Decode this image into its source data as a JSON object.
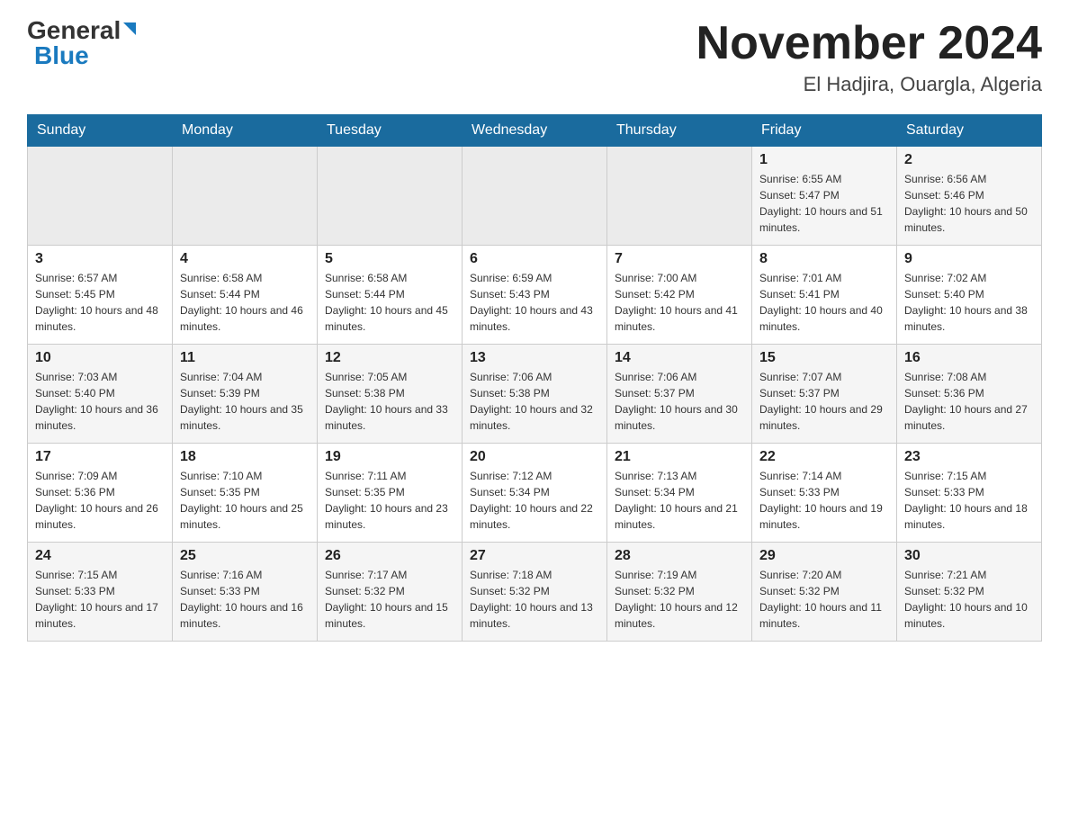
{
  "logo": {
    "general": "General",
    "blue": "Blue"
  },
  "calendar": {
    "title": "November 2024",
    "subtitle": "El Hadjira, Ouargla, Algeria",
    "days_of_week": [
      "Sunday",
      "Monday",
      "Tuesday",
      "Wednesday",
      "Thursday",
      "Friday",
      "Saturday"
    ],
    "weeks": [
      [
        {
          "day": "",
          "info": ""
        },
        {
          "day": "",
          "info": ""
        },
        {
          "day": "",
          "info": ""
        },
        {
          "day": "",
          "info": ""
        },
        {
          "day": "",
          "info": ""
        },
        {
          "day": "1",
          "info": "Sunrise: 6:55 AM\nSunset: 5:47 PM\nDaylight: 10 hours and 51 minutes."
        },
        {
          "day": "2",
          "info": "Sunrise: 6:56 AM\nSunset: 5:46 PM\nDaylight: 10 hours and 50 minutes."
        }
      ],
      [
        {
          "day": "3",
          "info": "Sunrise: 6:57 AM\nSunset: 5:45 PM\nDaylight: 10 hours and 48 minutes."
        },
        {
          "day": "4",
          "info": "Sunrise: 6:58 AM\nSunset: 5:44 PM\nDaylight: 10 hours and 46 minutes."
        },
        {
          "day": "5",
          "info": "Sunrise: 6:58 AM\nSunset: 5:44 PM\nDaylight: 10 hours and 45 minutes."
        },
        {
          "day": "6",
          "info": "Sunrise: 6:59 AM\nSunset: 5:43 PM\nDaylight: 10 hours and 43 minutes."
        },
        {
          "day": "7",
          "info": "Sunrise: 7:00 AM\nSunset: 5:42 PM\nDaylight: 10 hours and 41 minutes."
        },
        {
          "day": "8",
          "info": "Sunrise: 7:01 AM\nSunset: 5:41 PM\nDaylight: 10 hours and 40 minutes."
        },
        {
          "day": "9",
          "info": "Sunrise: 7:02 AM\nSunset: 5:40 PM\nDaylight: 10 hours and 38 minutes."
        }
      ],
      [
        {
          "day": "10",
          "info": "Sunrise: 7:03 AM\nSunset: 5:40 PM\nDaylight: 10 hours and 36 minutes."
        },
        {
          "day": "11",
          "info": "Sunrise: 7:04 AM\nSunset: 5:39 PM\nDaylight: 10 hours and 35 minutes."
        },
        {
          "day": "12",
          "info": "Sunrise: 7:05 AM\nSunset: 5:38 PM\nDaylight: 10 hours and 33 minutes."
        },
        {
          "day": "13",
          "info": "Sunrise: 7:06 AM\nSunset: 5:38 PM\nDaylight: 10 hours and 32 minutes."
        },
        {
          "day": "14",
          "info": "Sunrise: 7:06 AM\nSunset: 5:37 PM\nDaylight: 10 hours and 30 minutes."
        },
        {
          "day": "15",
          "info": "Sunrise: 7:07 AM\nSunset: 5:37 PM\nDaylight: 10 hours and 29 minutes."
        },
        {
          "day": "16",
          "info": "Sunrise: 7:08 AM\nSunset: 5:36 PM\nDaylight: 10 hours and 27 minutes."
        }
      ],
      [
        {
          "day": "17",
          "info": "Sunrise: 7:09 AM\nSunset: 5:36 PM\nDaylight: 10 hours and 26 minutes."
        },
        {
          "day": "18",
          "info": "Sunrise: 7:10 AM\nSunset: 5:35 PM\nDaylight: 10 hours and 25 minutes."
        },
        {
          "day": "19",
          "info": "Sunrise: 7:11 AM\nSunset: 5:35 PM\nDaylight: 10 hours and 23 minutes."
        },
        {
          "day": "20",
          "info": "Sunrise: 7:12 AM\nSunset: 5:34 PM\nDaylight: 10 hours and 22 minutes."
        },
        {
          "day": "21",
          "info": "Sunrise: 7:13 AM\nSunset: 5:34 PM\nDaylight: 10 hours and 21 minutes."
        },
        {
          "day": "22",
          "info": "Sunrise: 7:14 AM\nSunset: 5:33 PM\nDaylight: 10 hours and 19 minutes."
        },
        {
          "day": "23",
          "info": "Sunrise: 7:15 AM\nSunset: 5:33 PM\nDaylight: 10 hours and 18 minutes."
        }
      ],
      [
        {
          "day": "24",
          "info": "Sunrise: 7:15 AM\nSunset: 5:33 PM\nDaylight: 10 hours and 17 minutes."
        },
        {
          "day": "25",
          "info": "Sunrise: 7:16 AM\nSunset: 5:33 PM\nDaylight: 10 hours and 16 minutes."
        },
        {
          "day": "26",
          "info": "Sunrise: 7:17 AM\nSunset: 5:32 PM\nDaylight: 10 hours and 15 minutes."
        },
        {
          "day": "27",
          "info": "Sunrise: 7:18 AM\nSunset: 5:32 PM\nDaylight: 10 hours and 13 minutes."
        },
        {
          "day": "28",
          "info": "Sunrise: 7:19 AM\nSunset: 5:32 PM\nDaylight: 10 hours and 12 minutes."
        },
        {
          "day": "29",
          "info": "Sunrise: 7:20 AM\nSunset: 5:32 PM\nDaylight: 10 hours and 11 minutes."
        },
        {
          "day": "30",
          "info": "Sunrise: 7:21 AM\nSunset: 5:32 PM\nDaylight: 10 hours and 10 minutes."
        }
      ]
    ]
  }
}
